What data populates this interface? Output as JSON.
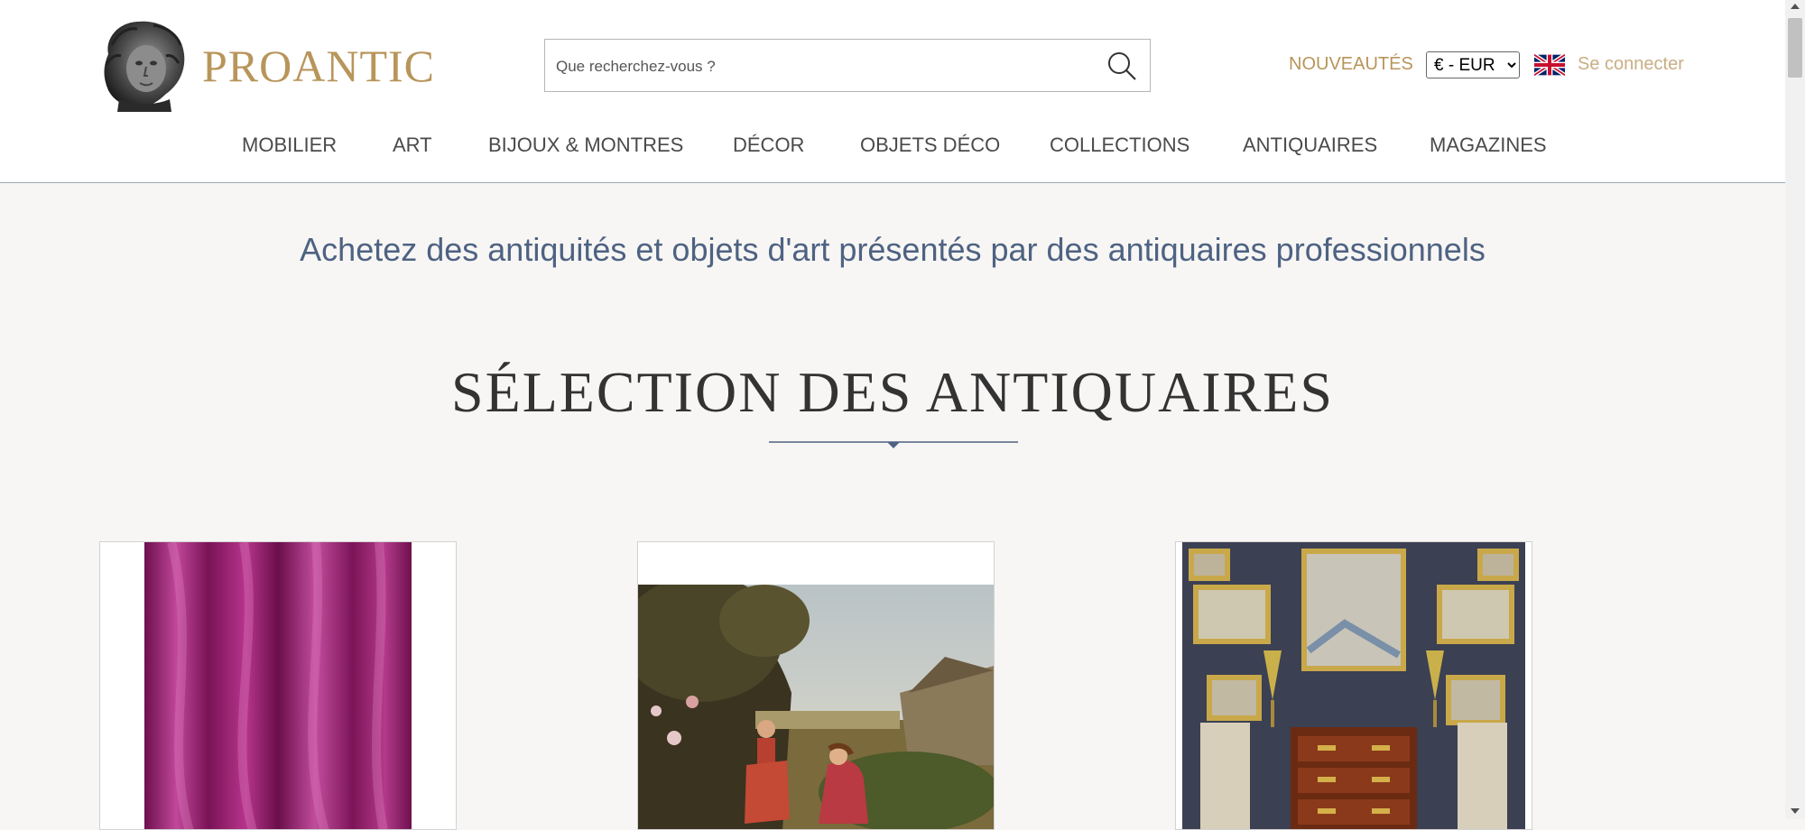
{
  "brand": {
    "name": "PROANTIC"
  },
  "search": {
    "placeholder": "Que recherchez-vous ?",
    "icon": "search-icon"
  },
  "topbar": {
    "news_label": "NOUVEAUTÉS",
    "currency": {
      "selected": "€ - EUR"
    },
    "language_icon": "uk-flag-icon",
    "login_label": "Se connecter"
  },
  "nav": {
    "items": [
      {
        "label": "MOBILIER"
      },
      {
        "label": "ART"
      },
      {
        "label": "BIJOUX & MONTRES"
      },
      {
        "label": "DÉCOR"
      },
      {
        "label": "OBJETS DÉCO"
      },
      {
        "label": "COLLECTIONS"
      },
      {
        "label": "ANTIQUAIRES"
      },
      {
        "label": "MAGAZINES"
      }
    ]
  },
  "hero": {
    "tagline": "Achetez des antiquités et objets d'art présentés par des antiquaires professionnels"
  },
  "selection": {
    "title": "SÉLECTION DES ANTIQUAIRES"
  },
  "colors": {
    "gold": "#b8955a",
    "navy": "#4e6282",
    "background": "#f7f6f4",
    "login": "#c9ae84"
  }
}
